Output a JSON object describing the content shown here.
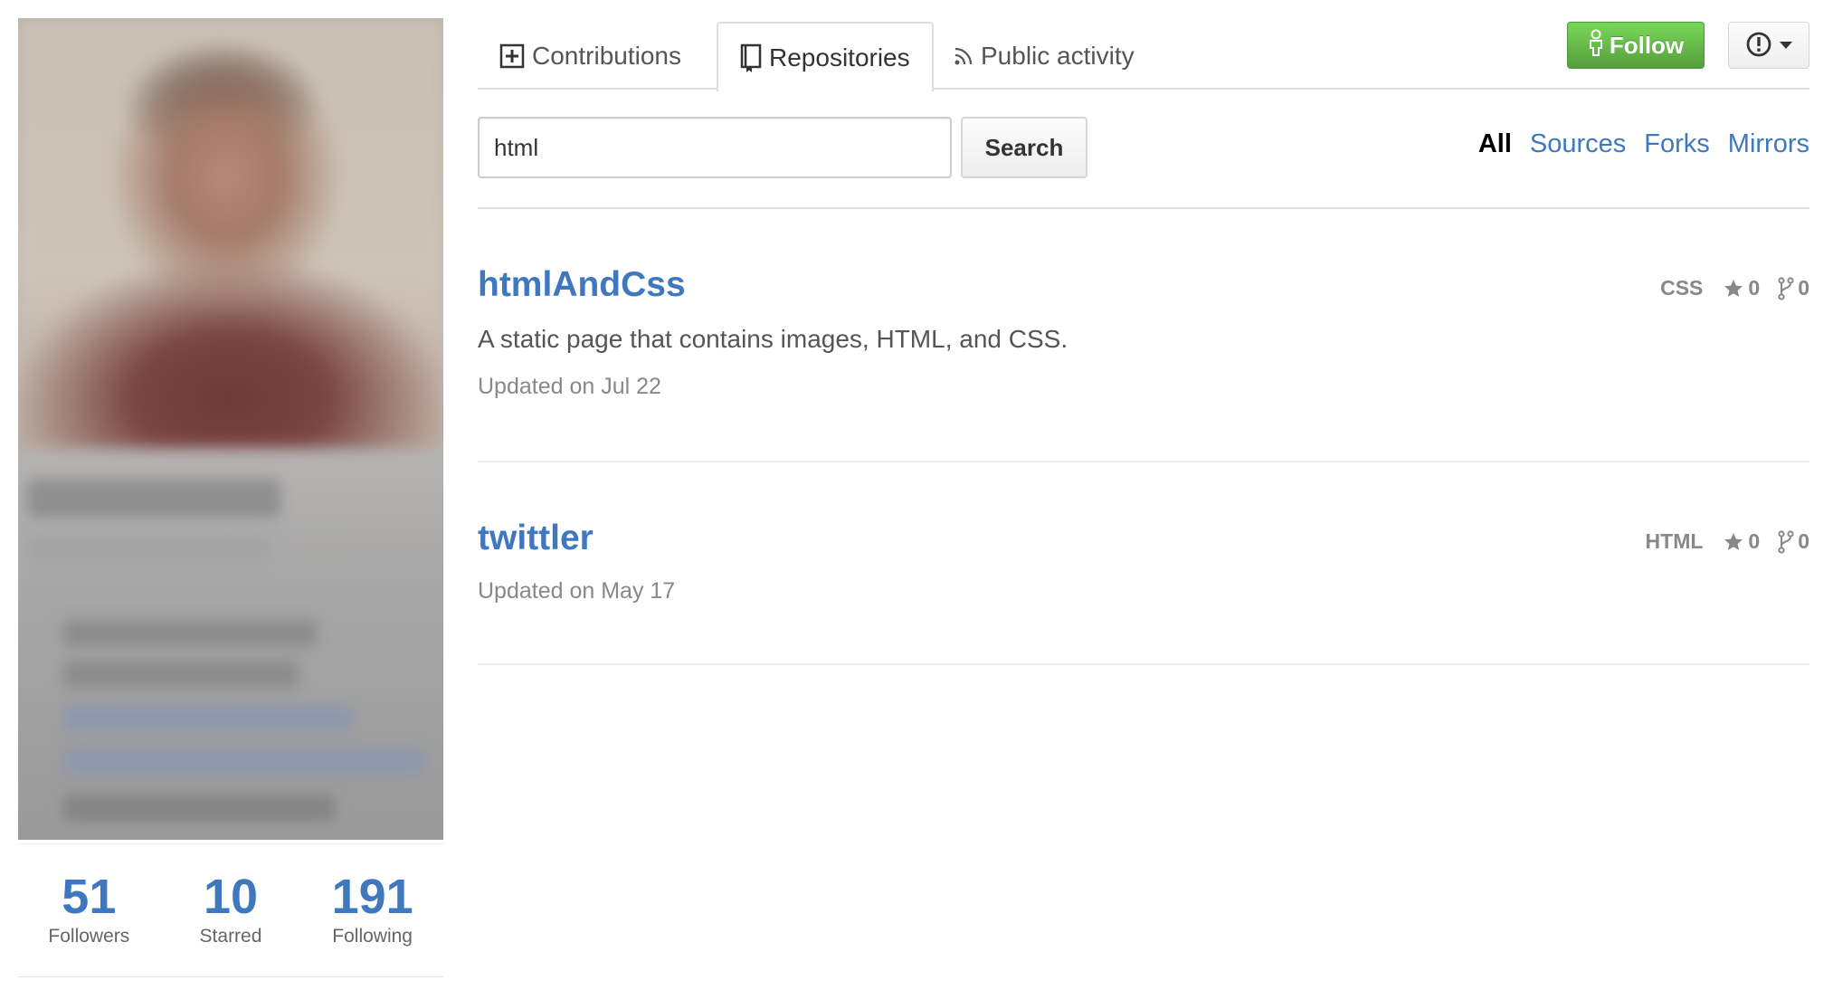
{
  "profile": {
    "stats": [
      {
        "count": "51",
        "label": "Followers"
      },
      {
        "count": "10",
        "label": "Starred"
      },
      {
        "count": "191",
        "label": "Following"
      }
    ]
  },
  "tabs": [
    {
      "label": "Contributions",
      "icon": "diff-added-icon"
    },
    {
      "label": "Repositories",
      "icon": "repo-book-icon",
      "selected": true
    },
    {
      "label": "Public activity",
      "icon": "rss-icon"
    }
  ],
  "actions": {
    "follow_label": "Follow",
    "follow_icon": "person-icon",
    "report_icon": "alert-circle-icon"
  },
  "search": {
    "value": "html",
    "button_label": "Search"
  },
  "filters": [
    {
      "label": "All",
      "selected": true
    },
    {
      "label": "Sources"
    },
    {
      "label": "Forks"
    },
    {
      "label": "Mirrors"
    }
  ],
  "repos": [
    {
      "name": "htmlAndCss",
      "description": "A static page that contains images, HTML, and CSS.",
      "updated": "Updated on Jul 22",
      "language": "CSS",
      "stars": "0",
      "forks": "0"
    },
    {
      "name": "twittler",
      "updated": "Updated on May 17",
      "language": "HTML",
      "stars": "0",
      "forks": "0"
    }
  ],
  "colors": {
    "link": "#4078c0",
    "follow_button": "#6cc644",
    "muted_text": "#888888"
  }
}
